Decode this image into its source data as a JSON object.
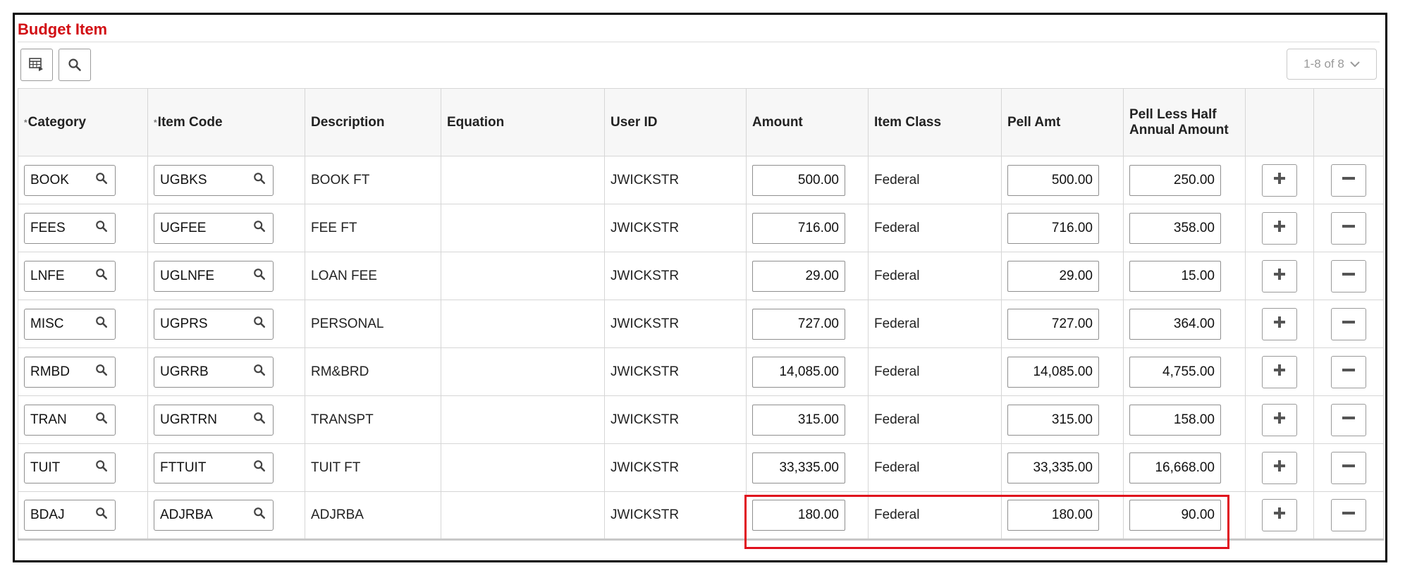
{
  "panel": {
    "title": "Budget Item",
    "pager": "1-8 of 8"
  },
  "toolbar": {
    "personalize_icon": "grid-personalize-icon",
    "find_icon": "search-icon"
  },
  "columns": {
    "category": "Category",
    "item_code": "Item Code",
    "description": "Description",
    "equation": "Equation",
    "user_id": "User ID",
    "amount": "Amount",
    "item_class": "Item Class",
    "pell_amt": "Pell Amt",
    "pell_less_half": "Pell Less Half Annual Amount"
  },
  "rows": [
    {
      "category": "BOOK",
      "item_code": "UGBKS",
      "description": "BOOK FT",
      "equation": "",
      "user_id": "JWICKSTR",
      "amount": "500.00",
      "item_class": "Federal",
      "pell_amt": "500.00",
      "pell_less_half": "250.00"
    },
    {
      "category": "FEES",
      "item_code": "UGFEE",
      "description": "FEE FT",
      "equation": "",
      "user_id": "JWICKSTR",
      "amount": "716.00",
      "item_class": "Federal",
      "pell_amt": "716.00",
      "pell_less_half": "358.00"
    },
    {
      "category": "LNFE",
      "item_code": "UGLNFE",
      "description": "LOAN FEE",
      "equation": "",
      "user_id": "JWICKSTR",
      "amount": "29.00",
      "item_class": "Federal",
      "pell_amt": "29.00",
      "pell_less_half": "15.00"
    },
    {
      "category": "MISC",
      "item_code": "UGPRS",
      "description": "PERSONAL",
      "equation": "",
      "user_id": "JWICKSTR",
      "amount": "727.00",
      "item_class": "Federal",
      "pell_amt": "727.00",
      "pell_less_half": "364.00"
    },
    {
      "category": "RMBD",
      "item_code": "UGRRB",
      "description": "RM&BRD",
      "equation": "",
      "user_id": "JWICKSTR",
      "amount": "14,085.00",
      "item_class": "Federal",
      "pell_amt": "14,085.00",
      "pell_less_half": "4,755.00"
    },
    {
      "category": "TRAN",
      "item_code": "UGRTRN",
      "description": "TRANSPT",
      "equation": "",
      "user_id": "JWICKSTR",
      "amount": "315.00",
      "item_class": "Federal",
      "pell_amt": "315.00",
      "pell_less_half": "158.00"
    },
    {
      "category": "TUIT",
      "item_code": "FTTUIT",
      "description": "TUIT FT",
      "equation": "",
      "user_id": "JWICKSTR",
      "amount": "33,335.00",
      "item_class": "Federal",
      "pell_amt": "33,335.00",
      "pell_less_half": "16,668.00"
    },
    {
      "category": "BDAJ",
      "item_code": "ADJRBA",
      "description": "ADJRBA",
      "equation": "",
      "user_id": "JWICKSTR",
      "amount": "180.00",
      "item_class": "Federal",
      "pell_amt": "180.00",
      "pell_less_half": "90.00"
    }
  ],
  "colors": {
    "title": "#d20f14",
    "highlight": "#e0101d"
  }
}
